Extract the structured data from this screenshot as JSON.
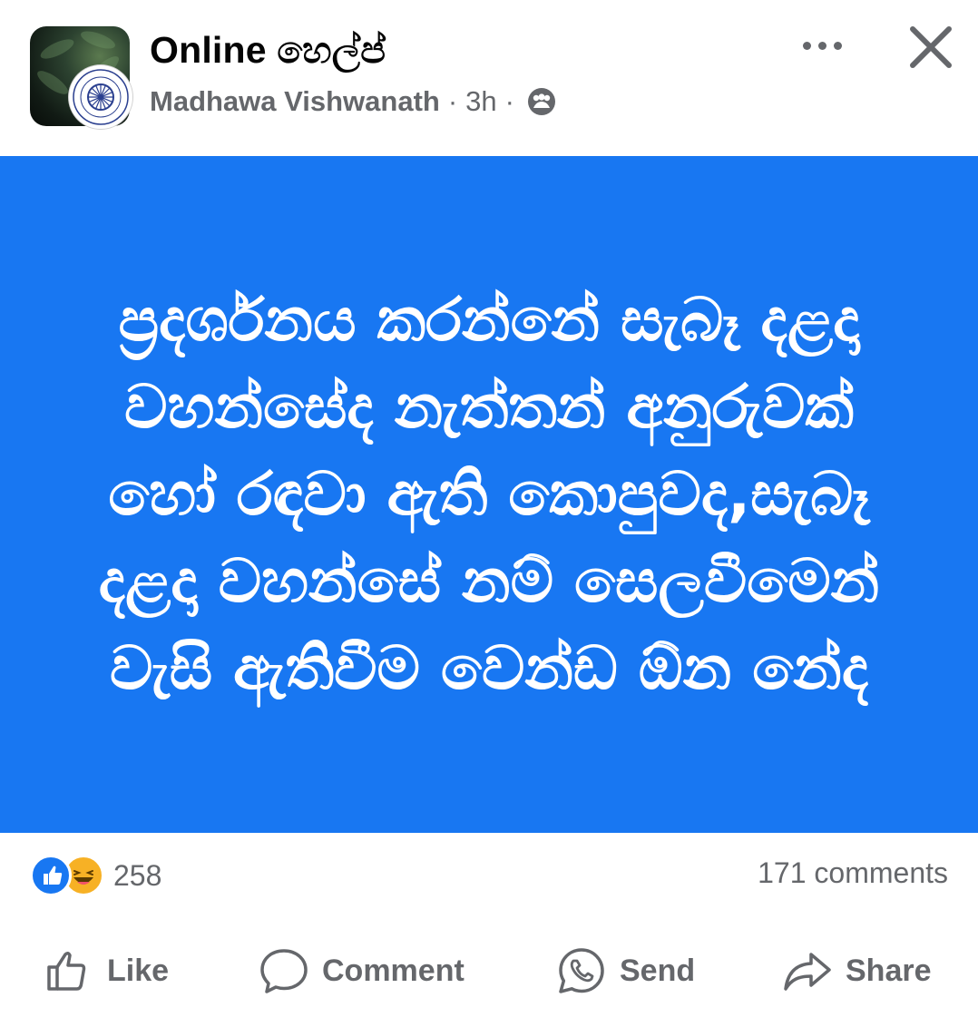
{
  "header": {
    "group_name": "Online හෙල්ප්",
    "author": "Madhawa Vishwanath",
    "separator": "·",
    "time": "3h",
    "privacy_icon": "group-members-icon",
    "more_icon": "more-options-icon",
    "close_icon": "close-icon"
  },
  "post": {
    "background_color": "#1877f2",
    "text_color": "#ffffff",
    "text": "ප්‍රදර්ශනය කරන්නේ සැබෑ දළදා වහන්සේද නැත්තන් අනුරුවක් හෝ රඳවා ඇති කොපුවද,සැබෑ දළදා වහන්සේ නම් සෙලවීමෙන් වැසි ඇතිවීම වෙන්ඩ ඕන නේද"
  },
  "reactions": {
    "icons": [
      "like-reaction-icon",
      "haha-reaction-icon"
    ],
    "count": "258",
    "comments": "171 comments"
  },
  "actions": {
    "like": "Like",
    "comment": "Comment",
    "send": "Send",
    "share": "Share"
  },
  "colors": {
    "accent": "#1877f2",
    "secondary_text": "#65676b"
  }
}
